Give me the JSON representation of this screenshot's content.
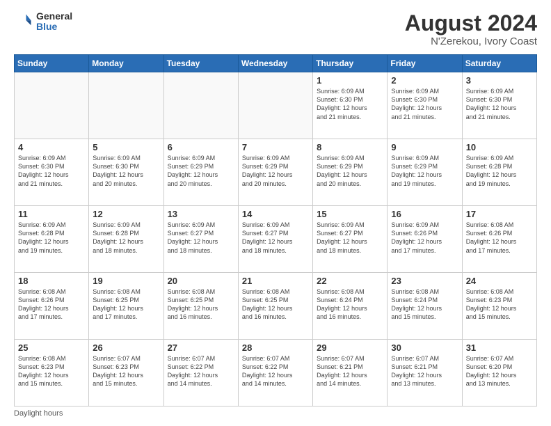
{
  "header": {
    "logo_general": "General",
    "logo_blue": "Blue",
    "main_title": "August 2024",
    "sub_title": "N'Zerekou, Ivory Coast"
  },
  "footer": {
    "note": "Daylight hours"
  },
  "weekdays": [
    "Sunday",
    "Monday",
    "Tuesday",
    "Wednesday",
    "Thursday",
    "Friday",
    "Saturday"
  ],
  "weeks": [
    [
      {
        "day": "",
        "info": ""
      },
      {
        "day": "",
        "info": ""
      },
      {
        "day": "",
        "info": ""
      },
      {
        "day": "",
        "info": ""
      },
      {
        "day": "1",
        "info": "Sunrise: 6:09 AM\nSunset: 6:30 PM\nDaylight: 12 hours\nand 21 minutes."
      },
      {
        "day": "2",
        "info": "Sunrise: 6:09 AM\nSunset: 6:30 PM\nDaylight: 12 hours\nand 21 minutes."
      },
      {
        "day": "3",
        "info": "Sunrise: 6:09 AM\nSunset: 6:30 PM\nDaylight: 12 hours\nand 21 minutes."
      }
    ],
    [
      {
        "day": "4",
        "info": "Sunrise: 6:09 AM\nSunset: 6:30 PM\nDaylight: 12 hours\nand 21 minutes."
      },
      {
        "day": "5",
        "info": "Sunrise: 6:09 AM\nSunset: 6:30 PM\nDaylight: 12 hours\nand 20 minutes."
      },
      {
        "day": "6",
        "info": "Sunrise: 6:09 AM\nSunset: 6:29 PM\nDaylight: 12 hours\nand 20 minutes."
      },
      {
        "day": "7",
        "info": "Sunrise: 6:09 AM\nSunset: 6:29 PM\nDaylight: 12 hours\nand 20 minutes."
      },
      {
        "day": "8",
        "info": "Sunrise: 6:09 AM\nSunset: 6:29 PM\nDaylight: 12 hours\nand 20 minutes."
      },
      {
        "day": "9",
        "info": "Sunrise: 6:09 AM\nSunset: 6:29 PM\nDaylight: 12 hours\nand 19 minutes."
      },
      {
        "day": "10",
        "info": "Sunrise: 6:09 AM\nSunset: 6:28 PM\nDaylight: 12 hours\nand 19 minutes."
      }
    ],
    [
      {
        "day": "11",
        "info": "Sunrise: 6:09 AM\nSunset: 6:28 PM\nDaylight: 12 hours\nand 19 minutes."
      },
      {
        "day": "12",
        "info": "Sunrise: 6:09 AM\nSunset: 6:28 PM\nDaylight: 12 hours\nand 18 minutes."
      },
      {
        "day": "13",
        "info": "Sunrise: 6:09 AM\nSunset: 6:27 PM\nDaylight: 12 hours\nand 18 minutes."
      },
      {
        "day": "14",
        "info": "Sunrise: 6:09 AM\nSunset: 6:27 PM\nDaylight: 12 hours\nand 18 minutes."
      },
      {
        "day": "15",
        "info": "Sunrise: 6:09 AM\nSunset: 6:27 PM\nDaylight: 12 hours\nand 18 minutes."
      },
      {
        "day": "16",
        "info": "Sunrise: 6:09 AM\nSunset: 6:26 PM\nDaylight: 12 hours\nand 17 minutes."
      },
      {
        "day": "17",
        "info": "Sunrise: 6:08 AM\nSunset: 6:26 PM\nDaylight: 12 hours\nand 17 minutes."
      }
    ],
    [
      {
        "day": "18",
        "info": "Sunrise: 6:08 AM\nSunset: 6:26 PM\nDaylight: 12 hours\nand 17 minutes."
      },
      {
        "day": "19",
        "info": "Sunrise: 6:08 AM\nSunset: 6:25 PM\nDaylight: 12 hours\nand 17 minutes."
      },
      {
        "day": "20",
        "info": "Sunrise: 6:08 AM\nSunset: 6:25 PM\nDaylight: 12 hours\nand 16 minutes."
      },
      {
        "day": "21",
        "info": "Sunrise: 6:08 AM\nSunset: 6:25 PM\nDaylight: 12 hours\nand 16 minutes."
      },
      {
        "day": "22",
        "info": "Sunrise: 6:08 AM\nSunset: 6:24 PM\nDaylight: 12 hours\nand 16 minutes."
      },
      {
        "day": "23",
        "info": "Sunrise: 6:08 AM\nSunset: 6:24 PM\nDaylight: 12 hours\nand 15 minutes."
      },
      {
        "day": "24",
        "info": "Sunrise: 6:08 AM\nSunset: 6:23 PM\nDaylight: 12 hours\nand 15 minutes."
      }
    ],
    [
      {
        "day": "25",
        "info": "Sunrise: 6:08 AM\nSunset: 6:23 PM\nDaylight: 12 hours\nand 15 minutes."
      },
      {
        "day": "26",
        "info": "Sunrise: 6:07 AM\nSunset: 6:23 PM\nDaylight: 12 hours\nand 15 minutes."
      },
      {
        "day": "27",
        "info": "Sunrise: 6:07 AM\nSunset: 6:22 PM\nDaylight: 12 hours\nand 14 minutes."
      },
      {
        "day": "28",
        "info": "Sunrise: 6:07 AM\nSunset: 6:22 PM\nDaylight: 12 hours\nand 14 minutes."
      },
      {
        "day": "29",
        "info": "Sunrise: 6:07 AM\nSunset: 6:21 PM\nDaylight: 12 hours\nand 14 minutes."
      },
      {
        "day": "30",
        "info": "Sunrise: 6:07 AM\nSunset: 6:21 PM\nDaylight: 12 hours\nand 13 minutes."
      },
      {
        "day": "31",
        "info": "Sunrise: 6:07 AM\nSunset: 6:20 PM\nDaylight: 12 hours\nand 13 minutes."
      }
    ]
  ]
}
